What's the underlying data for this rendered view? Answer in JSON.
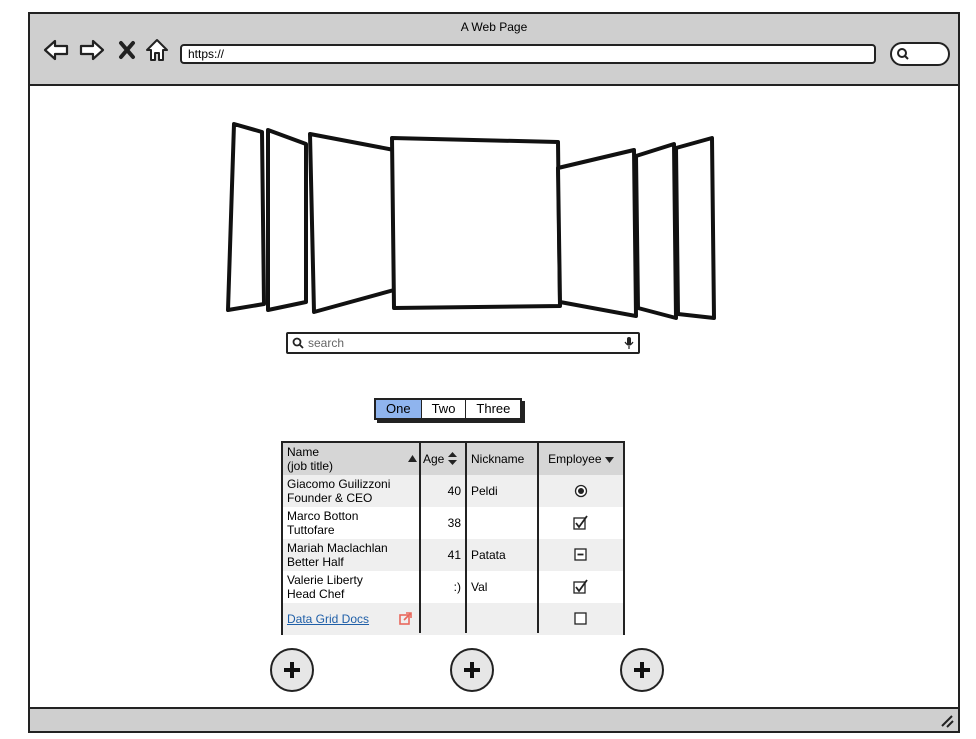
{
  "window": {
    "title": "A Web Page"
  },
  "toolbar": {
    "url": "https://"
  },
  "search": {
    "placeholder": "search"
  },
  "tabs": [
    {
      "label": "One",
      "selected": true
    },
    {
      "label": "Two",
      "selected": false
    },
    {
      "label": "Three",
      "selected": false
    }
  ],
  "grid": {
    "columns": {
      "name_line1": "Name",
      "name_line2": "(job title)",
      "age": "Age",
      "nickname": "Nickname",
      "employee": "Employee"
    },
    "rows": [
      {
        "name": "Giacomo Guilizzoni",
        "title": "Founder & CEO",
        "age": "40",
        "nickname": "Peldi",
        "employee": "radio-selected"
      },
      {
        "name": "Marco Botton",
        "title": "Tuttofare",
        "age": "38",
        "nickname": "",
        "employee": "checked"
      },
      {
        "name": "Mariah Maclachlan",
        "title": "Better Half",
        "age": "41",
        "nickname": "Patata",
        "employee": "indeterminate"
      },
      {
        "name": "Valerie Liberty",
        "title": "Head Chef",
        "age": ":)",
        "nickname": "Val",
        "employee": "checked"
      }
    ],
    "footer": {
      "link": "Data Grid Docs",
      "employee": "unchecked"
    }
  },
  "colors": {
    "tab_selected": "#8fb4ee",
    "link": "#1f5fa8",
    "external_icon": "#e8685c"
  }
}
